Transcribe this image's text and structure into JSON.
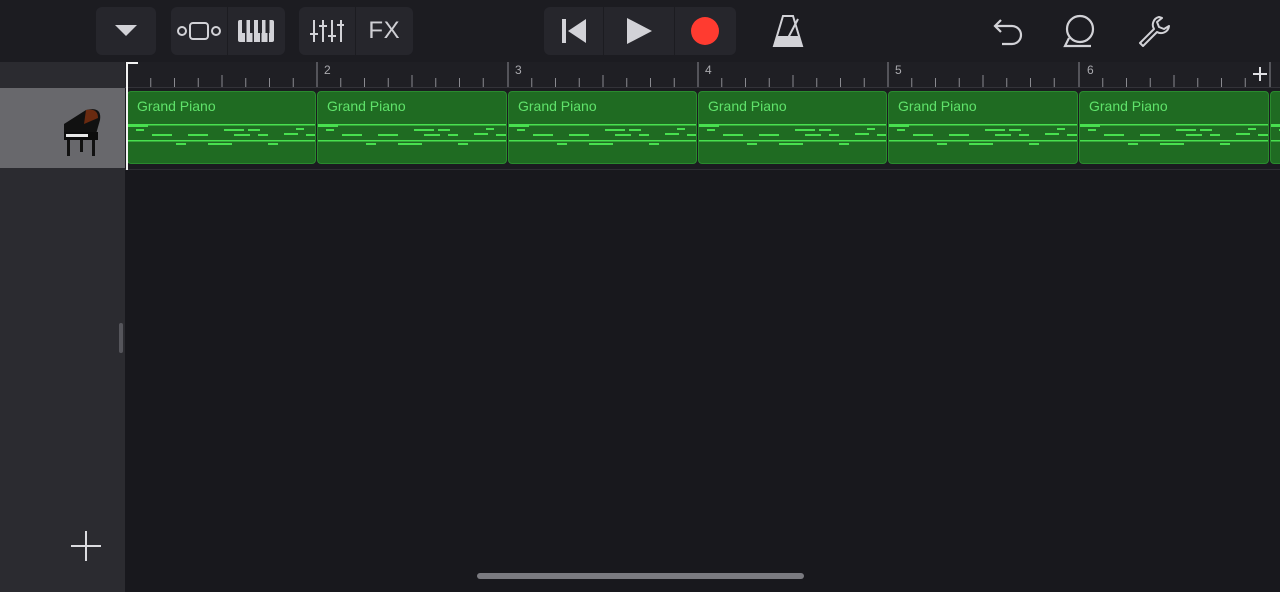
{
  "toolbar": {
    "buttons": [
      {
        "name": "browser-dropdown",
        "icon": "chevron-down-icon"
      },
      {
        "name": "tracks-view",
        "icon": "tracks-view-icon"
      },
      {
        "name": "keyboard",
        "icon": "piano-keys-icon"
      },
      {
        "name": "mixer",
        "icon": "mixer-sliders-icon"
      },
      {
        "name": "fx",
        "label": "FX"
      },
      {
        "name": "go-to-beginning",
        "icon": "skip-back-icon"
      },
      {
        "name": "play",
        "icon": "play-icon"
      },
      {
        "name": "record",
        "icon": "record-icon"
      },
      {
        "name": "metronome",
        "icon": "metronome-icon"
      },
      {
        "name": "undo",
        "icon": "undo-icon"
      },
      {
        "name": "loop-browser",
        "icon": "loop-icon"
      },
      {
        "name": "settings",
        "icon": "wrench-icon"
      }
    ],
    "fx_label": "FX"
  },
  "ruler": {
    "bar_numbers": [
      "2",
      "3",
      "4",
      "5",
      "6"
    ],
    "add_section_icon": "plus-icon"
  },
  "track": {
    "instrument_icon": "grand-piano-icon",
    "regions": [
      {
        "label": "Grand Piano"
      },
      {
        "label": "Grand Piano"
      },
      {
        "label": "Grand Piano"
      },
      {
        "label": "Grand Piano"
      },
      {
        "label": "Grand Piano"
      },
      {
        "label": "Grand Piano"
      }
    ]
  },
  "sidebar": {
    "add_track_icon": "plus-icon"
  },
  "colors": {
    "region_fill": "#1f6b22",
    "region_text": "#5fe36a",
    "note_color": "#48e04f",
    "record_red": "#ff3b30"
  }
}
